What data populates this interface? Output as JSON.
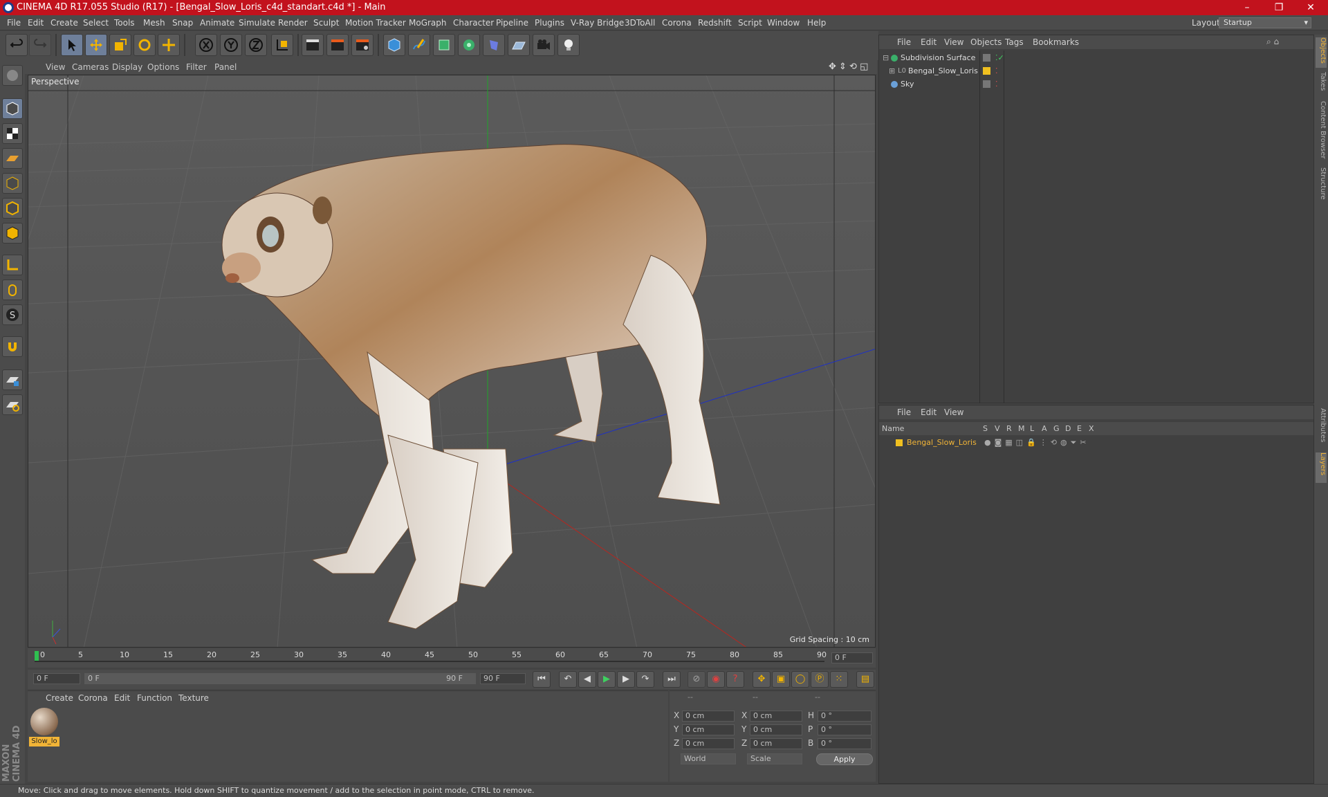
{
  "window": {
    "title": "CINEMA 4D R17.055 Studio (R17) - [Bengal_Slow_Loris_c4d_standart.c4d *] - Main",
    "controls": [
      "–",
      "❐",
      "✕"
    ]
  },
  "menu": [
    "File",
    "Edit",
    "Create",
    "Select",
    "Tools",
    "Mesh",
    "Snap",
    "Animate",
    "Simulate",
    "Render",
    "Sculpt",
    "Motion Tracker",
    "MoGraph",
    "Character",
    "Pipeline",
    "Plugins",
    "V-Ray Bridge",
    "3DToAll",
    "Corona",
    "Redshift",
    "Script",
    "Window",
    "Help"
  ],
  "layout": {
    "label": "Layout:",
    "value": "Startup"
  },
  "viewport": {
    "menu": [
      "View",
      "Cameras",
      "Display",
      "Options",
      "Filter",
      "Panel"
    ],
    "name": "Perspective",
    "grid_spacing": "Grid Spacing : 10 cm"
  },
  "timeline": {
    "ticks": [
      "0",
      "5",
      "10",
      "15",
      "20",
      "25",
      "30",
      "35",
      "40",
      "45",
      "50",
      "55",
      "60",
      "65",
      "70",
      "75",
      "80",
      "85",
      "90"
    ],
    "current": "0 F",
    "start": "0 F",
    "range_start": "0 F",
    "range_end": "90 F",
    "end": "90 F"
  },
  "object_manager": {
    "menu": [
      "File",
      "Edit",
      "View",
      "Objects",
      "Tags",
      "Bookmarks"
    ],
    "objects": [
      {
        "name": "Subdivision Surface"
      },
      {
        "name": "Bengal_Slow_Loris"
      },
      {
        "name": "Sky"
      }
    ]
  },
  "layer_manager": {
    "menu": [
      "File",
      "Edit",
      "View"
    ],
    "columns": [
      "Name",
      "S",
      "V",
      "R",
      "M",
      "L",
      "A",
      "G",
      "D",
      "E",
      "X"
    ],
    "layers": [
      {
        "name": "Bengal_Slow_Loris",
        "color": "#f0c020"
      }
    ]
  },
  "material_manager": {
    "menu": [
      "Create",
      "Corona",
      "Edit",
      "Function",
      "Texture"
    ],
    "material": {
      "name": "Slow_lo"
    }
  },
  "coordinates": {
    "header": [
      "--",
      "--",
      "--"
    ],
    "rows": [
      {
        "a": "X",
        "av": "0 cm",
        "b": "X",
        "bv": "0 cm",
        "c": "H",
        "cv": "0 °"
      },
      {
        "a": "Y",
        "av": "0 cm",
        "b": "Y",
        "bv": "0 cm",
        "c": "P",
        "cv": "0 °"
      },
      {
        "a": "Z",
        "av": "0 cm",
        "b": "Z",
        "bv": "0 cm",
        "c": "B",
        "cv": "0 °"
      }
    ],
    "mode1": "World",
    "mode2": "Scale",
    "apply": "Apply"
  },
  "right_tabs": [
    "Objects",
    "Takes",
    "Content Browser",
    "Structure",
    "Attributes",
    "Layers"
  ],
  "status": "Move: Click and drag to move elements. Hold down SHIFT to quantize movement / add to the selection in point mode, CTRL to remove.",
  "brand": "MAXON CINEMA 4D",
  "colors": {
    "title_bar": "#c2121d",
    "accent": "#f1b437",
    "selection": "#6e7f9a"
  }
}
